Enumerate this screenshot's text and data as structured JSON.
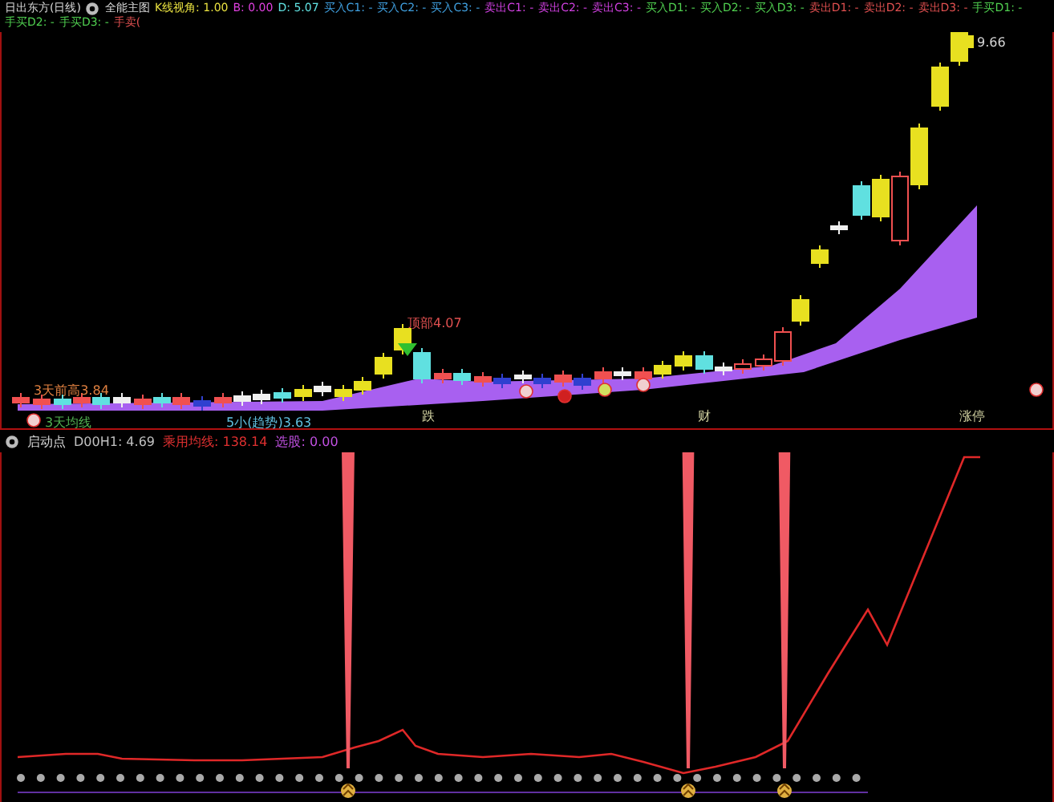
{
  "main_panel": {
    "title": "日出东方(日线)",
    "indicator": "全能主图",
    "readings": [
      {
        "text": "K线视角: 1.00",
        "color": "#e8e040"
      },
      {
        "text": "B: 0.00",
        "color": "#e040e0"
      },
      {
        "text": "D: 5.07",
        "color": "#60e0e0"
      }
    ],
    "signals": [
      {
        "text": "买入C1: -",
        "color": "#40a0e0"
      },
      {
        "text": "买入C2: -",
        "color": "#40a0e0"
      },
      {
        "text": "买入C3: -",
        "color": "#40a0e0"
      },
      {
        "text": "卖出C1: -",
        "color": "#d040e0"
      },
      {
        "text": "卖出C2: -",
        "color": "#d040e0"
      },
      {
        "text": "卖出C3: -",
        "color": "#d040e0"
      },
      {
        "text": "买入D1: -",
        "color": "#50d050"
      },
      {
        "text": "买入D2: -",
        "color": "#50d050"
      },
      {
        "text": "买入D3: -",
        "color": "#50d050"
      },
      {
        "text": "卖出D1: -",
        "color": "#e05050"
      },
      {
        "text": "卖出D2: -",
        "color": "#e05050"
      },
      {
        "text": "卖出D3: -",
        "color": "#e05050"
      },
      {
        "text": "手买D1: -",
        "color": "#50d050"
      },
      {
        "text": "手买D2: -",
        "color": "#50d050"
      },
      {
        "text": "手买D3: -",
        "color": "#50d050"
      },
      {
        "text": "手卖(",
        "color": "#e05050"
      }
    ],
    "labels": [
      {
        "kind": "price",
        "text": "9.66"
      },
      {
        "kind": "top",
        "text": "顶部4.07"
      },
      {
        "kind": "high",
        "text": "3天前高3.84"
      },
      {
        "kind": "ma",
        "text": "3天均线"
      },
      {
        "kind": "trend",
        "text": "5小(趋势)3.63"
      },
      {
        "kind": "tag",
        "text": "跌"
      },
      {
        "kind": "tag",
        "text": "财"
      },
      {
        "kind": "tag",
        "text": "涨停"
      }
    ]
  },
  "sub_panel": {
    "title": "启动点",
    "readings": [
      {
        "text": "D00H1: 4.69",
        "color": "#c0c0c0"
      },
      {
        "text": "乘用均线: 138.14",
        "color": "#e03030"
      },
      {
        "text": "选股: 0.00",
        "color": "#c050e0"
      }
    ]
  }
}
